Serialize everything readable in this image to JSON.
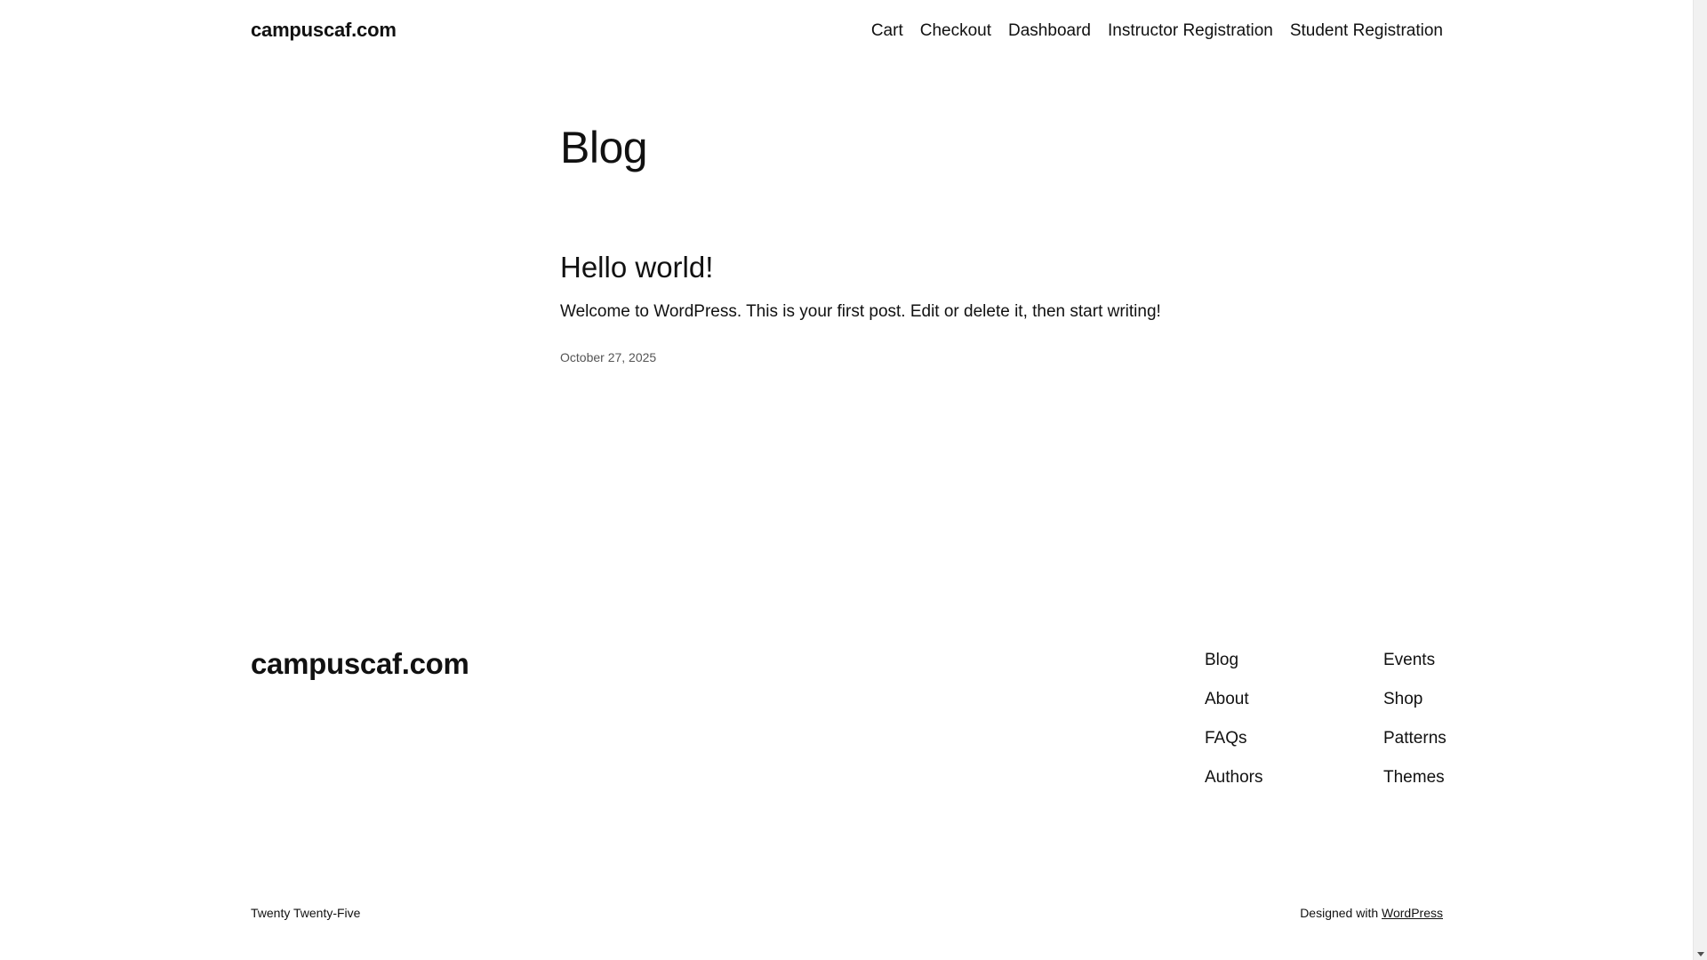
{
  "header": {
    "site_title": "campuscaf.com",
    "nav": [
      {
        "label": "Cart"
      },
      {
        "label": "Checkout"
      },
      {
        "label": "Dashboard"
      },
      {
        "label": "Instructor Registration"
      },
      {
        "label": "Student Registration"
      }
    ]
  },
  "main": {
    "heading": "Blog",
    "posts": [
      {
        "title": "Hello world!",
        "excerpt": "Welcome to WordPress. This is your first post. Edit or delete it, then start writing!",
        "date": "October 27, 2025"
      }
    ]
  },
  "footer": {
    "site_title": "campuscaf.com",
    "columns": [
      {
        "links": [
          {
            "label": "Blog"
          },
          {
            "label": "About"
          },
          {
            "label": "FAQs"
          },
          {
            "label": "Authors"
          }
        ]
      },
      {
        "links": [
          {
            "label": "Events"
          },
          {
            "label": "Shop"
          },
          {
            "label": "Patterns"
          },
          {
            "label": "Themes"
          }
        ]
      }
    ],
    "theme_name": "Twenty Twenty-Five",
    "designed_with_text": "Designed with",
    "designed_with_link": "WordPress"
  }
}
